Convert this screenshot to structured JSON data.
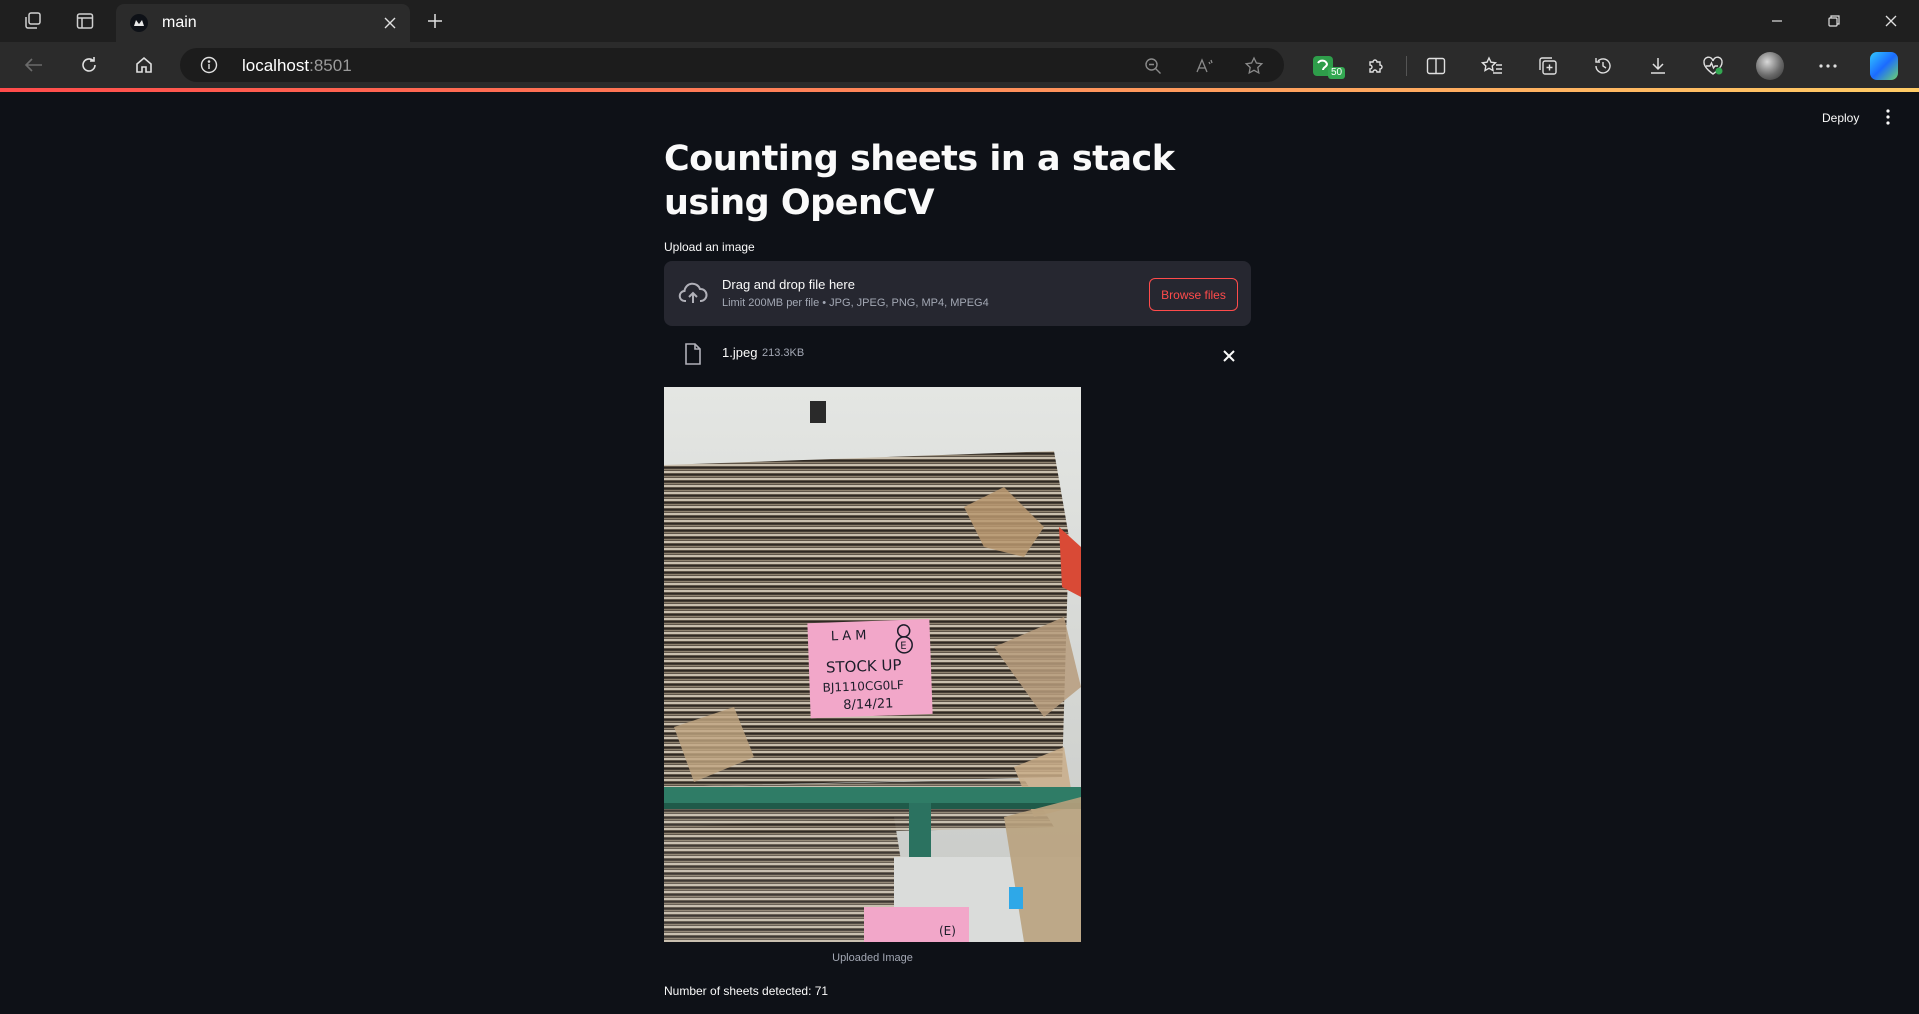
{
  "browser": {
    "tab": {
      "title": "main"
    },
    "address": {
      "host": "localhost",
      "port": ":8501"
    },
    "extension_badge": "50"
  },
  "app": {
    "header": {
      "deploy_label": "Deploy"
    },
    "title": "Counting sheets in a stack using OpenCV",
    "uploader": {
      "label": "Upload an image",
      "dropzone_title": "Drag and drop file here",
      "dropzone_limits": "Limit 200MB per file • JPG, JPEG, PNG, MP4, MPEG4",
      "browse_label": "Browse files"
    },
    "uploaded_file": {
      "name": "1.jpeg",
      "size": "213.3KB"
    },
    "image": {
      "caption": "Uploaded Image",
      "sticky_note_lines": [
        "LAM ⑧",
        "(E)",
        "STOCK UP",
        "BJ1110CG0LF",
        "8/14/21"
      ]
    },
    "result_text": "Number of sheets detected: 71"
  },
  "colors": {
    "app_bg": "#0e1117",
    "dropzone_bg": "#262730",
    "accent": "#ff4b4b",
    "text": "#fafafa",
    "muted_text": "#a3a8b4"
  }
}
